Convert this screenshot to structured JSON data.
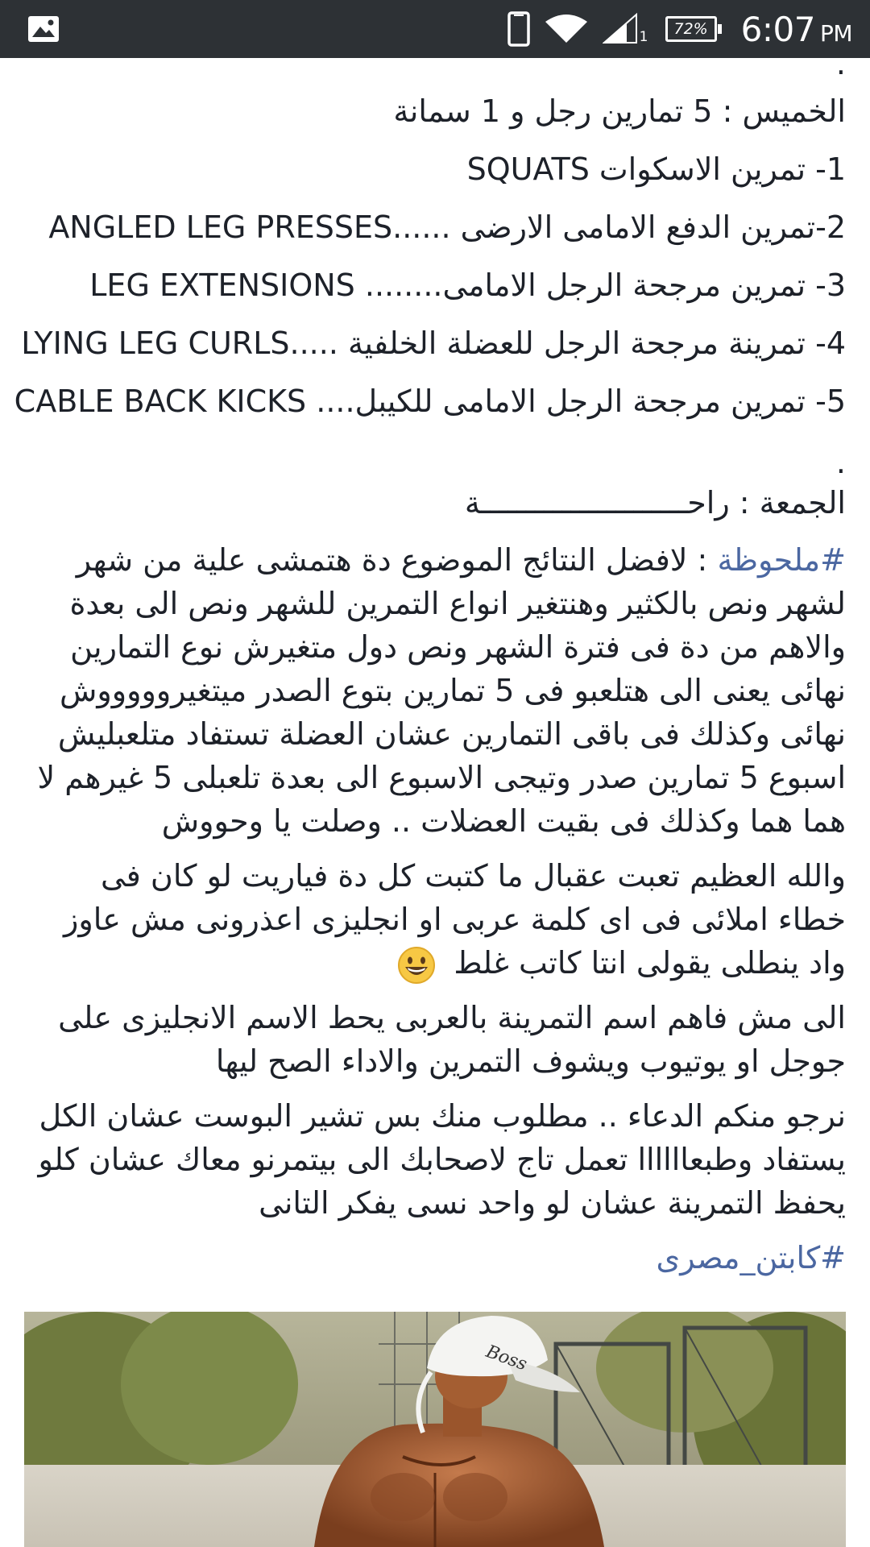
{
  "status_bar": {
    "time": "6:07",
    "ampm": "PM",
    "battery": "72%",
    "signal_sub": "1",
    "icons": [
      "gallery-icon",
      "phone-icon",
      "wifi-icon",
      "signal-icon",
      "battery-icon"
    ],
    "background": "#2d3135"
  },
  "post": {
    "top_dot": ".",
    "thursday_title": "الخميس : 5 تمارين رجل و 1 سمانة",
    "exercises": [
      "1- تمرين الاسكوات SQUATS",
      "2-تمرين الدفع الامامى الارضى ......ANGLED LEG PRESSES",
      "3- تمرين مرجحة الرجل الامامى........ LEG EXTENSIONS",
      "4- تمرينة مرجحة الرجل للعضلة الخلفية .....LYING LEG CURLS",
      "5- تمرين مرجحة الرجل الامامى للكيبل.... CABLE BACK KICKS"
    ],
    "mid_dot": ".",
    "friday": "الجمعة : راحـــــــــــــــــــــــة",
    "note_hashtag": "#ملحوظة",
    "note_text": " : لافضل النتائج الموضوع دة هتمشى علية من شهر لشهر ونص بالكثير وهنتغير انواع التمرين للشهر ونص الى بعدة والاهم من دة فى فترة الشهر ونص دول متغيرش نوع التمارين نهائى يعنى الى هتلعبو فى 5 تمارين بتوع الصدر ميتغيروووووش نهائى وكذلك فى باقى التمارين عشان العضلة تستفاد متلعبليش اسبوع 5 تمارين صدر وتيجى الاسبوع الى بعدة تلعبلى 5 غيرهم لا هما هما وكذلك فى بقيت العضلات .. وصلت يا وحووش",
    "oath_text": "والله العظيم تعبت عقبال ما كتبت كل دة فياريت لو كان فى خطاء املائى فى اى كلمة عربى او انجليزى اعذرونى مش عاوز واد ينطلى يقولى انتا كاتب غلط",
    "emoji": "grinning-face-emoji",
    "google_text": "الى مش فاهم اسم التمرينة بالعربى يحط الاسم الانجليزى على جوجل او يوتيوب ويشوف التمرين والاداء الصح ليها",
    "share_text": "نرجو منكم الدعاء .. مطلوب منك بس تشير البوست عشان الكل يستفاد وطبعاااااا تعمل تاج لاصحابك الى بيتمرنو معاك عشان كلو يحفظ التمرينة عشان لو واحد نسى يفكر التانى",
    "signature_hashtag": "#كابتن_مصرى",
    "hashtag_color": "#4b67a1",
    "text_color": "#1d2129"
  },
  "photo": {
    "subject": "man-in-white-cap-outdoors-photo",
    "cap_text": "Boss"
  }
}
